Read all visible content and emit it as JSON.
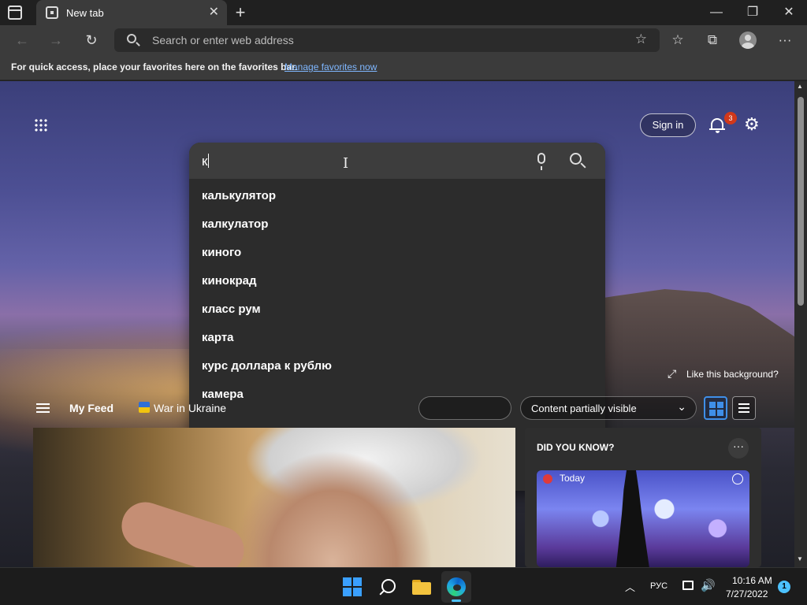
{
  "browser": {
    "tab": {
      "title": "New tab",
      "close": "✕"
    },
    "new_tab": "+",
    "window_controls": {
      "minimize": "—",
      "restore": "❐",
      "close": "✕"
    },
    "nav": {
      "back": "←",
      "forward": "→",
      "refresh": "↻"
    },
    "address_bar": {
      "placeholder": "Search or enter web address",
      "value": ""
    },
    "toolbar": {
      "add_favorite": "☆",
      "favorites": "☆",
      "collections": "⧉",
      "more": "···"
    },
    "favorites_bar": {
      "message": "For quick access, place your favorites here on the favorites bar.",
      "link": "Manage favorites now"
    }
  },
  "new_tab_page": {
    "sign_in": "Sign in",
    "notifications_count": "3",
    "settings_icon": "⚙",
    "search": {
      "value": "к",
      "suggestions": [
        "калькулятор",
        "калкулатор",
        "киного",
        "кинокрад",
        "класс рум",
        "карта",
        "курс доллара к рублю",
        "камера"
      ]
    },
    "feed_bar": {
      "my_feed": "My Feed",
      "war_topic": "War in Ukraine",
      "content_visibility": "Content partially visible",
      "chevron": "⌄"
    },
    "like_background": {
      "icon": "⤢",
      "label": "Like this background?"
    },
    "did_you_know": {
      "title": "DID YOU KNOW?",
      "more": "···",
      "today": "Today"
    }
  },
  "scrollbar": {
    "up": "▲",
    "down": "▼"
  },
  "taskbar": {
    "tray_chevron": "︿",
    "language": "РУС",
    "volume": "🔊",
    "time": "10:16 AM",
    "date": "7/27/2022",
    "notifications": "1"
  }
}
